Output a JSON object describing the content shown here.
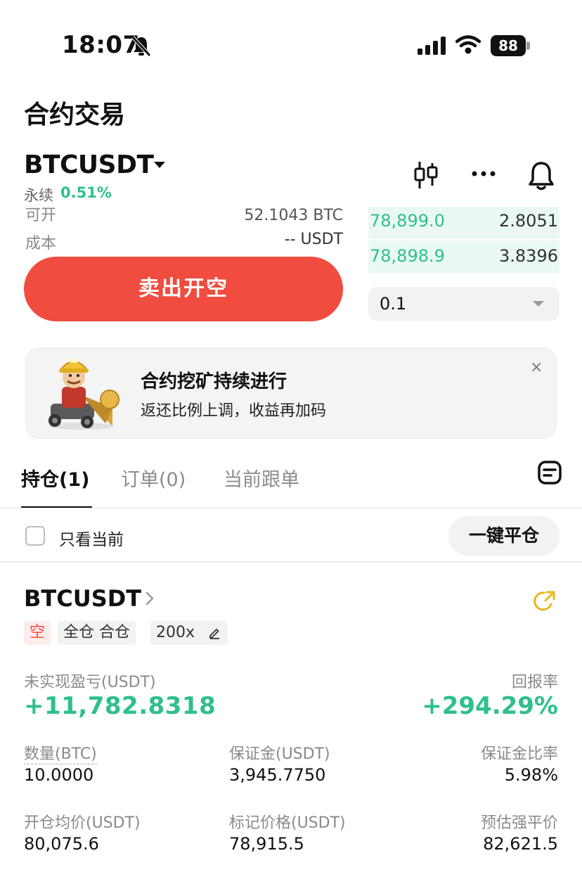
{
  "status_bar": {
    "time": "18:07",
    "battery": "88"
  },
  "header": {
    "title": "合约交易"
  },
  "market": {
    "symbol": "BTCUSDT",
    "type": "永续",
    "change": "0.51%"
  },
  "order_panel": {
    "available_label": "可开",
    "available_value": "52.1043 BTC",
    "cost_label": "成本",
    "cost_value": "-- USDT",
    "sell_button": "卖出开空",
    "order_book": [
      {
        "price": "78,899.0",
        "qty": "2.8051"
      },
      {
        "price": "78,898.9",
        "qty": "3.8396"
      }
    ],
    "precision_select": "0.1"
  },
  "promo": {
    "title": "合约挖矿持续进行",
    "subtitle": "返还比例上调，收益再加码",
    "close": "×"
  },
  "tabs": [
    {
      "label": "持仓(1)"
    },
    {
      "label": "订单(0)"
    },
    {
      "label": "当前跟单"
    }
  ],
  "filter": {
    "only_current": "只看当前",
    "close_all": "一键平仓"
  },
  "position": {
    "symbol": "BTCUSDT",
    "side": "空",
    "margin_mode": "全仓 合仓",
    "leverage": "200x",
    "pnl_label": "未实现盈亏(USDT)",
    "pnl_value": "+11,782.8318",
    "roe_label": "回报率",
    "roe_value": "+294.29%",
    "fields": [
      {
        "label": "数量(BTC)",
        "value": "10.0000"
      },
      {
        "label": "保证金(USDT)",
        "value": "3,945.7750"
      },
      {
        "label": "保证金比率",
        "value": "5.98%"
      },
      {
        "label": "开仓均价(USDT)",
        "value": "80,075.6"
      },
      {
        "label": "标记价格(USDT)",
        "value": "78,915.5"
      },
      {
        "label": "预估强平价",
        "value": "82,621.5"
      }
    ]
  },
  "colors": {
    "accent_green": "#2fbf8f",
    "sell_red": "#f04c3f"
  },
  "icons": [
    "bell-off-icon",
    "signal-icon",
    "wifi-icon",
    "candlestick-icon",
    "more-icon",
    "bell-icon",
    "document-icon",
    "share-icon",
    "edit-icon",
    "chevron-right-icon",
    "dropdown-caret-icon",
    "close-icon"
  ]
}
